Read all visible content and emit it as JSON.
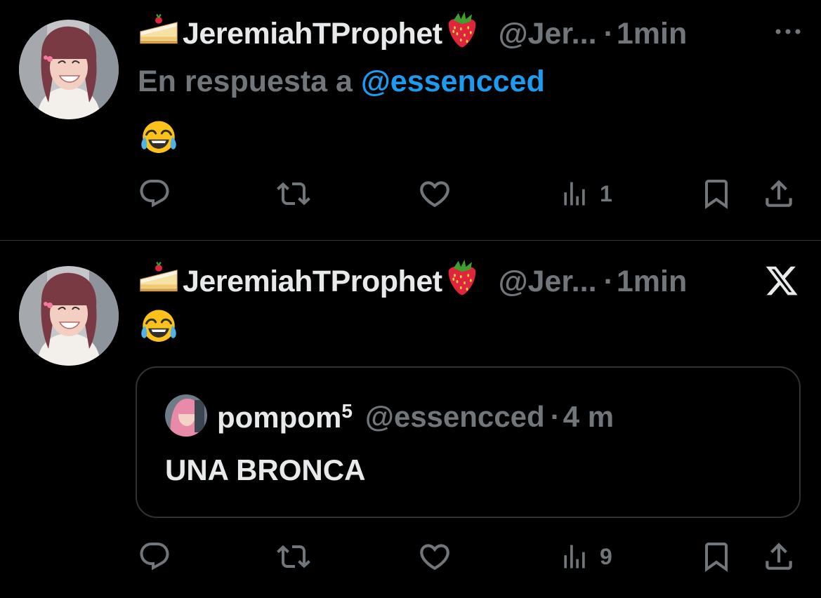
{
  "colors": {
    "background": "#000000",
    "text_primary": "#e7e9ea",
    "text_secondary": "#71767b",
    "link": "#1d9bf0",
    "divider": "#2f3336"
  },
  "tweets": [
    {
      "name_prefix_icon": "shortcake-emoji-icon",
      "display_name": "JeremiahTProphet",
      "name_suffix_icon": "strawberry-emoji-icon",
      "handle": "@Jer...",
      "separator": "·",
      "time": "1min",
      "reply_prefix": "En respuesta a ",
      "reply_to": "@essencced",
      "body_emoji": "tears-of-joy-emoji-icon",
      "views": "1"
    },
    {
      "name_prefix_icon": "shortcake-emoji-icon",
      "display_name": "JeremiahTProphet",
      "name_suffix_icon": "strawberry-emoji-icon",
      "handle": "@Jer...",
      "separator": "·",
      "time": "1min",
      "body_emoji": "tears-of-joy-emoji-icon",
      "views": "9",
      "quote": {
        "display_name": "pompom",
        "superscript": "5",
        "handle": "@essencced",
        "separator": "·",
        "time": "4 m",
        "text": "UNA BRONCA"
      }
    }
  ],
  "icons": [
    "more-icon",
    "x-logo-icon",
    "reply-icon",
    "retweet-icon",
    "like-icon",
    "views-icon",
    "bookmark-icon",
    "share-icon"
  ]
}
